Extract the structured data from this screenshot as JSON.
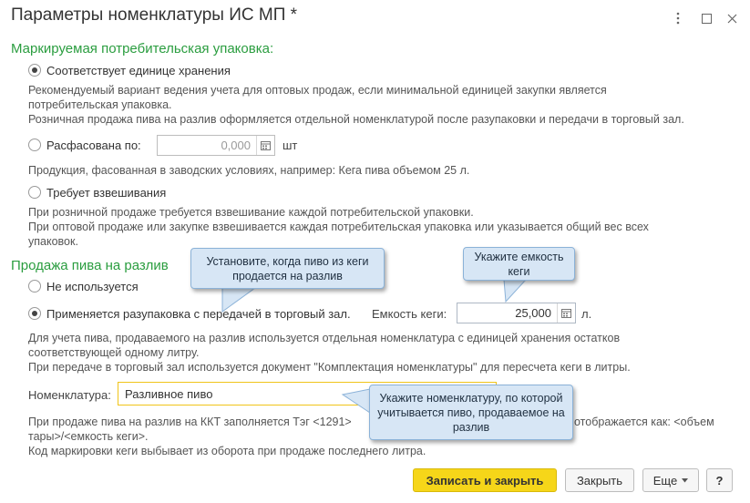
{
  "window": {
    "title": "Параметры номенклатуры ИС МП *"
  },
  "packaging": {
    "heading": "Маркируемая потребительская упаковка:",
    "option_unit": "Соответствует единице хранения",
    "option_unit_desc1": "Рекомендуемый вариант ведения учета для оптовых продаж, если минимальной единицей закупки является",
    "option_unit_desc2": "потребительская упаковка.",
    "option_unit_desc3": "Розничная продажа пива на разлив оформляется отдельной номенклатурой после разупаковки и передачи в торговый зал.",
    "option_packed": "Расфасована по:",
    "packed_value": "0,000",
    "packed_unit": "шт",
    "option_packed_desc": "Продукция, фасованная в заводских условиях, например: Кега пива объемом 25 л.",
    "option_weigh": "Требует взвешивания",
    "option_weigh_desc1": "При розничной продаже требуется взвешивание каждой потребительской упаковки.",
    "option_weigh_desc2": "При оптовой продаже или закупке взвешивается каждая потребительская упаковка или указывается общий вес всех",
    "option_weigh_desc3": "упаковок.",
    "selected": "unit"
  },
  "draft": {
    "heading": "Продажа пива на разлив",
    "option_not_used": "Не используется",
    "option_unpack": "Применяется разупаковка с передачей в торговый зал.",
    "capacity_label": "Емкость кеги:",
    "capacity_value": "25,000",
    "capacity_unit": "л.",
    "desc1": "Для учета пива, продаваемого на разлив используется отдельная номенклатура с единицей хранения остатков",
    "desc2": "соответствующей одному литру.",
    "desc3": "При передаче в торговый зал используется документ \"Комплектация номенклатуры\" для пересчета кеги в литры.",
    "nomenclature_label": "Номенклатура:",
    "nomenclature_value": "Разливное пиво",
    "note1_start": "При продаже пива на разлив на ККТ заполняется Тэг <1291>",
    "note1_end": "отображается как: <объем",
    "note2": "тары>/<емкость кеги>.",
    "note3": "Код маркировки кеги выбывает из оборота при продаже последнего литра.",
    "selected": "unpack"
  },
  "tooltips": {
    "tip_keg_sold": "Установите, когда пиво из кеги продается на разлив",
    "tip_capacity": "Укажите емкость кеги",
    "tip_nomenclature": "Укажите номенклатуру, по которой учитывается пиво, продаваемое на разлив"
  },
  "buttons": {
    "save_close": "Записать и закрыть",
    "close": "Закрыть",
    "more": "Еще",
    "help": "?"
  },
  "icons": {
    "menu": "kebab-menu-icon",
    "maximize": "maximize-icon",
    "close": "close-icon",
    "calendar": "calendar-icon",
    "dropdown": "chevron-down-icon"
  },
  "colors": {
    "section_heading": "#2a9d3f",
    "primary_button": "#f6d619",
    "tooltip_bg": "#d7e6f5",
    "focus_border": "#f0c419"
  }
}
